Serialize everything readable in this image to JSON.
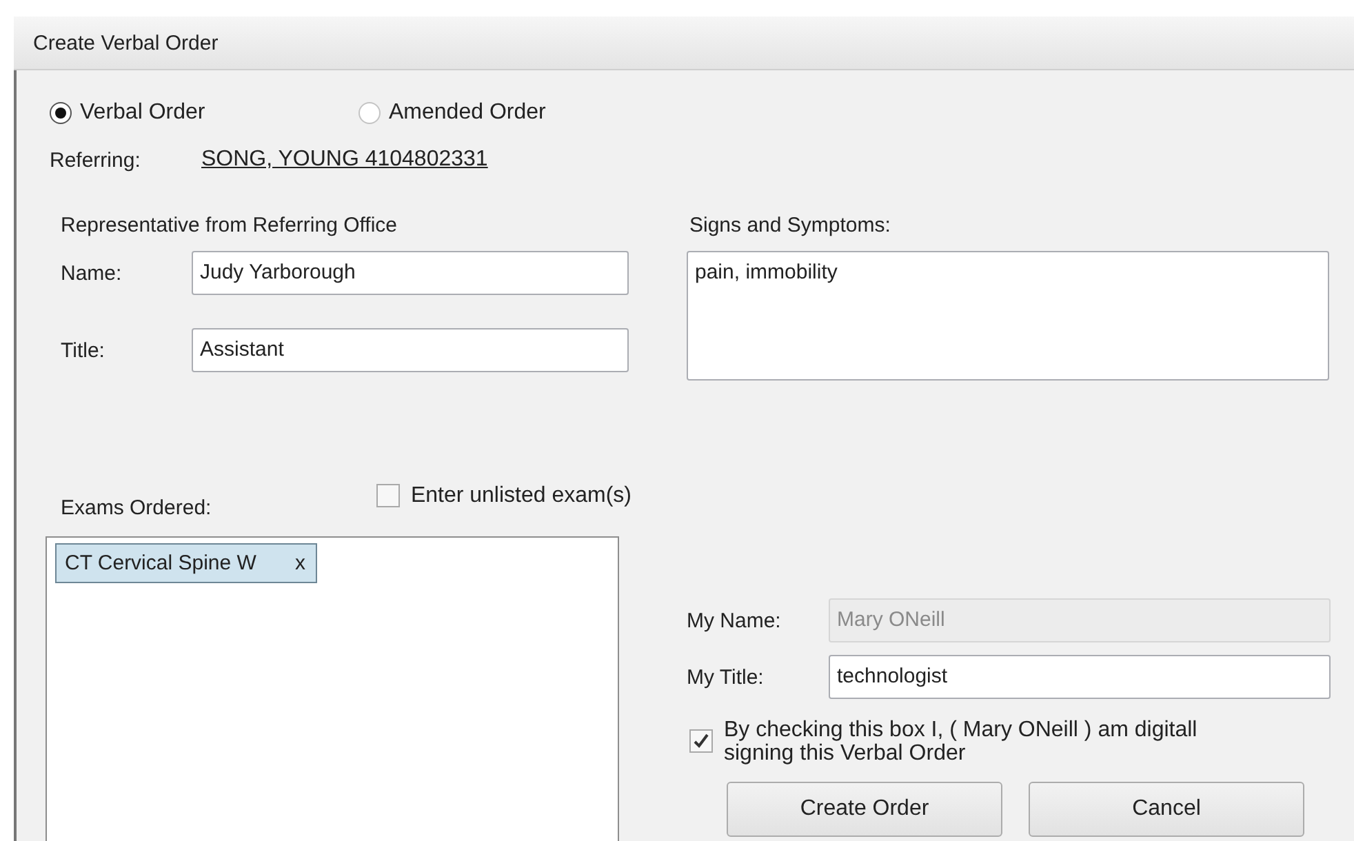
{
  "window": {
    "title": "Create Verbal Order"
  },
  "order_type": [
    {
      "label": "Verbal Order",
      "selected": true
    },
    {
      "label": "Amended Order",
      "selected": false
    }
  ],
  "referring": {
    "label": "Referring:",
    "value": "SONG, YOUNG  4104802331"
  },
  "representative": {
    "heading": "Representative from Referring Office",
    "name_label": "Name:",
    "name_value": "Judy Yarborough",
    "title_label": "Title:",
    "title_value": "Assistant"
  },
  "exams": {
    "label": "Exams Ordered:",
    "unlisted": {
      "label": "Enter unlisted exam(s)",
      "checked": false
    },
    "items": [
      {
        "label": "CT Cervical Spine W",
        "remove": "x"
      }
    ]
  },
  "signs": {
    "label": "Signs and Symptoms:",
    "value": "pain, immobility"
  },
  "my_name": {
    "label": "My Name:",
    "value": "Mary ONeill",
    "disabled": true
  },
  "my_title": {
    "label": "My Title:",
    "value": "technologist",
    "disabled": false
  },
  "signature": {
    "checked": true,
    "lines": [
      "By checking this box I, ( Mary ONeill ) am digitall",
      "signing this Verbal Order"
    ]
  },
  "buttons": [
    "Create Order",
    "Cancel"
  ]
}
